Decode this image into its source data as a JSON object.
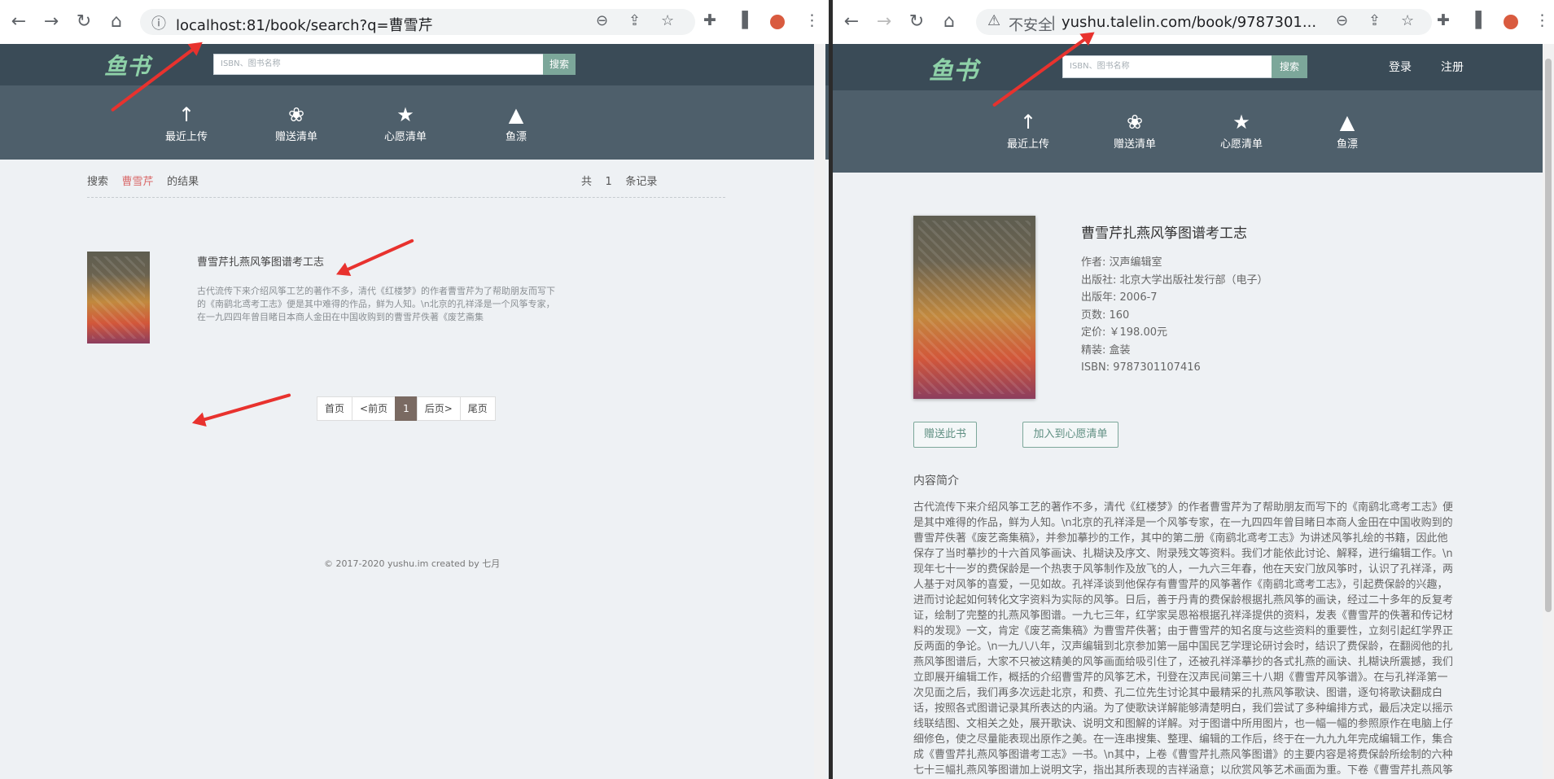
{
  "left": {
    "url": "localhost:81/book/search?q=曹雪芹",
    "logo": "鱼书",
    "search_placeholder": "ISBN、图书名称",
    "search_btn": "搜索",
    "nav": [
      {
        "icon": "↑",
        "label": "最近上传"
      },
      {
        "icon": "❀",
        "label": "赠送清单"
      },
      {
        "icon": "★",
        "label": "心愿清单"
      },
      {
        "icon": "▲",
        "label": "鱼漂"
      }
    ],
    "results": {
      "prefix": "搜索",
      "keyword": "曹雪芹",
      "suffix": "的结果",
      "count_prefix": "共",
      "count": "1",
      "count_suffix": "条记录"
    },
    "book": {
      "title": "曹雪芹扎燕风筝图谱考工志",
      "summary": "古代流传下来介绍风筝工艺的著作不多，清代《红楼梦》的作者曹雪芹为了帮助朋友而写下的《南鹞北鸢考工志》便是其中难得的作品，鲜为人知。\\n北京的孔祥泽是一个风筝专家，在一九四四年曾目睹日本商人金田在中国收购到的曹雪芹佚著《废艺斋集"
    },
    "pager": [
      "首页",
      "<前页",
      "1",
      "后页>",
      "尾页"
    ],
    "footer": "© 2017-2020 yushu.im created by 七月"
  },
  "right": {
    "not_secure": "不安全",
    "url": "yushu.talelin.com/book/9787301...",
    "logo": "鱼书",
    "search_placeholder": "ISBN、图书名称",
    "search_btn": "搜索",
    "login": "登录",
    "register": "注册",
    "nav": [
      {
        "icon": "↑",
        "label": "最近上传"
      },
      {
        "icon": "❀",
        "label": "赠送清单"
      },
      {
        "icon": "★",
        "label": "心愿清单"
      },
      {
        "icon": "▲",
        "label": "鱼漂"
      }
    ],
    "book": {
      "title": "曹雪芹扎燕风筝图谱考工志",
      "author": "作者: 汉声编辑室",
      "publisher": "出版社: 北京大学出版社发行部（电子）",
      "pubdate": "出版年:   2006-7",
      "pages": "页数:   160",
      "price": "定价:   ￥198.00元",
      "binding": "精装:   盒装",
      "isbn": "ISBN:   9787301107416"
    },
    "gift_btn": "赠送此书",
    "wish_btn": "加入到心愿清单",
    "intro_title": "内容简介",
    "intro_lines": [
      "古代流传下来介绍风筝工艺的著作不多，清代《红楼梦》的作者曹雪芹为了帮助朋友而写下的《南鹞北鸢考工志》便",
      "是其中难得的作品，鲜为人知。\\n北京的孔祥泽是一个风筝专家，在一九四四年曾目睹日本商人金田在中国收购到的",
      "曹雪芹佚著《废艺斋集稿》，并参加摹抄的工作，其中的第二册《南鹞北鸢考工志》为讲述风筝扎绘的书籍，因此他",
      "保存了当时摹抄的十六首风筝画诀、扎糊诀及序文、附录残文等资料。我们才能依此讨论、解释，进行编辑工作。\\n",
      "现年七十一岁的费保龄是一个热衷于风筝制作及放飞的人，一九六三年春，他在天安门放风筝时，认识了孔祥泽，两",
      "人基于对风筝的喜爱，一见如故。孔祥泽谈到他保存有曹雪芹的风筝著作《南鹞北鸢考工志》，引起费保龄的兴趣，",
      "进而讨论起如何转化文字资料为实际的风筝。日后，善于丹青的费保龄根据扎燕风筝的画诀，经过二十多年的反复考",
      "证，绘制了完整的扎燕风筝图谱。一九七三年，红学家吴恩裕根据孔祥泽提供的资料，发表《曹雪芹的佚著和传记材",
      "料的发现》一文，肯定《废艺斋集稿》为曹雪芹佚著；由于曹雪芹的知名度与这些资料的重要性，立刻引起红学界正",
      "反两面的争论。\\n一九八八年，汉声编辑到北京参加第一届中国民艺学理论研讨会时，结识了费保龄，在翻阅他的扎",
      "燕风筝图谱后，大家不只被这精美的风筝画面给吸引住了，还被孔祥泽摹抄的各式扎燕的画诀、扎糊诀所震撼，我们",
      "立即展开编辑工作，概括的介绍曹雪芹的风筝艺术，刊登在汉声民间第三十八期《曹雪芹风筝谱》。在与孔祥泽第一",
      "次见面之后，我们再多次远赴北京，和费、孔二位先生讨论其中最精采的扎燕风筝歌诀、图谱，逐句将歌诀翻成白",
      "话，按照各式图谱记录其所表达的内涵。为了使歌诀详解能够清楚明白，我们尝试了多种编排方式，最后决定以摇示",
      "线联结图、文相关之处，展开歌诀、说明文和图解的详解。对于图谱中所用图片，也一幅一幅的参照原作在电脑上仔",
      "细修色，使之尽量能表现出原作之美。在一连串搜集、整理、编辑的工作后，终于在一九九九年完成编辑工作，集合",
      "成《曹雪芹扎燕风筝图谱考工志》一书。\\n其中，上卷《曹雪芹扎燕风筝图谱》的主要内容是将费保龄所绘制的六种",
      "七十三幅扎燕风筝图谱加上说明文字，指出其所表现的吉祥涵意；以欣赏风筝艺术画面为重。下卷《曹雪芹扎燕风筝"
    ]
  }
}
